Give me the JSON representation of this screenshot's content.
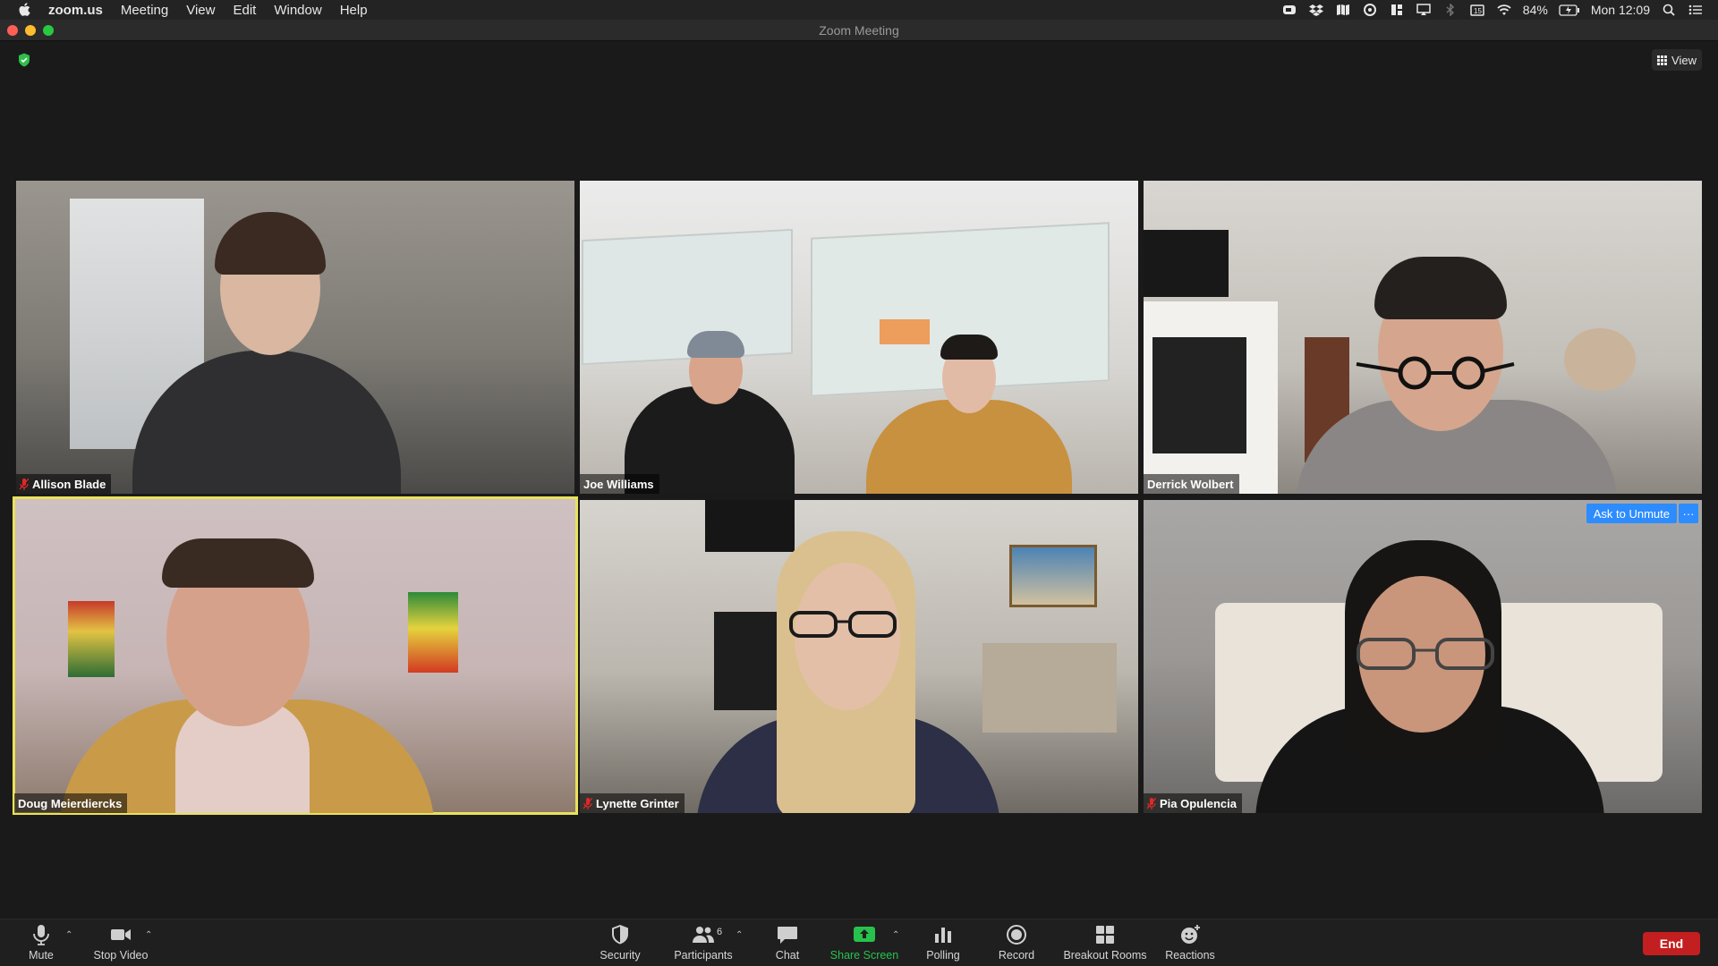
{
  "menubar": {
    "app": "zoom.us",
    "items": [
      "Meeting",
      "View",
      "Edit",
      "Window",
      "Help"
    ],
    "battery": "84%",
    "clock": "Mon 12:09"
  },
  "window": {
    "title": "Zoom Meeting"
  },
  "meeting": {
    "view_label": "View",
    "participants": [
      {
        "name": "Allison Blade",
        "muted": true,
        "bg": "#8a8680"
      },
      {
        "name": "Joe Williams",
        "muted": false,
        "bg": "#cfcac3"
      },
      {
        "name": "Derrick Wolbert",
        "muted": false,
        "bg": "#b5b0a8"
      },
      {
        "name": "Doug Meierdiercks",
        "muted": false,
        "active": true,
        "bg": "#c9b4b6"
      },
      {
        "name": "Lynette Grinter",
        "muted": true,
        "bg": "#9b9389"
      },
      {
        "name": "Pia Opulencia",
        "muted": true,
        "bg": "#a7a5a1"
      }
    ],
    "ask_to_unmute": "Ask to Unmute",
    "more_label": "···"
  },
  "toolbar": {
    "mute": "Mute",
    "stop_video": "Stop Video",
    "security": "Security",
    "participants": "Participants",
    "participants_count": "6",
    "chat": "Chat",
    "share_screen": "Share Screen",
    "polling": "Polling",
    "record": "Record",
    "breakout_rooms": "Breakout Rooms",
    "reactions": "Reactions",
    "end": "End"
  },
  "colors": {
    "accent_blue": "#2D8CFF",
    "active_speaker": "#e9e25a",
    "share_green": "#27c24c",
    "end_red": "#c41f20"
  }
}
